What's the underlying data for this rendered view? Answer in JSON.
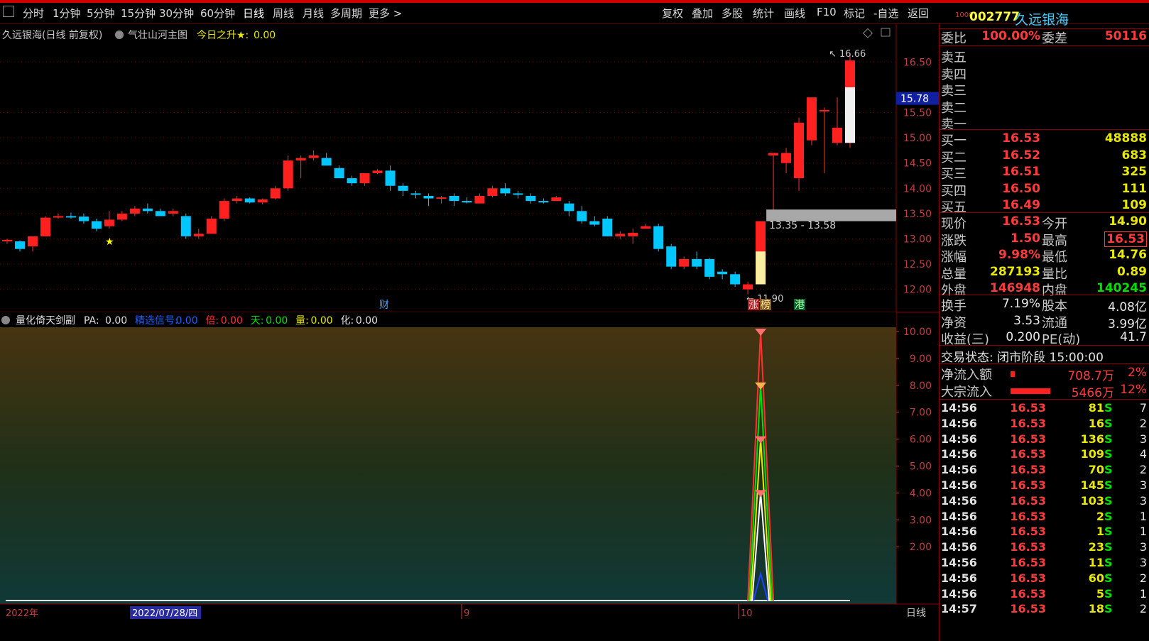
{
  "toolbar": {
    "left": [
      "分时",
      "1分钟",
      "5分钟",
      "15分钟",
      "30分钟",
      "60分钟",
      "日线",
      "周线",
      "月线",
      "多周期",
      "更多 >"
    ],
    "active": "日线",
    "right": [
      "复权",
      "叠加",
      "多股",
      "统计",
      "画线",
      "F10",
      "标记",
      "-自选",
      "返回"
    ]
  },
  "main_legend": {
    "stock": "久远银海(日线 前复权)",
    "indicator": "气壮山河主图",
    "today_rise_label": "今日之升★:",
    "today_rise_value": "0.00"
  },
  "sub_legend": {
    "name": "量化倚天剑副",
    "items": [
      {
        "label": "PA:",
        "value": "0.00",
        "color": "#e0e0e0"
      },
      {
        "label": "精选信号:",
        "value": "0.00",
        "color": "#2060ff"
      },
      {
        "label": "倍:",
        "value": "0.00",
        "color": "#ff3030"
      },
      {
        "label": "天:",
        "value": "0.00",
        "color": "#00e000"
      },
      {
        "label": "量:",
        "value": "0.00",
        "color": "#e8e800"
      },
      {
        "label": "化:",
        "value": "0.00",
        "color": "#e0e0e0"
      }
    ]
  },
  "chart_data": [
    {
      "type": "candlestick",
      "title": "久远银海(日线 前复权)",
      "yticks": [
        "16.50",
        "15.50",
        "15.00",
        "14.50",
        "14.00",
        "13.50",
        "13.00",
        "12.50",
        "12.00"
      ],
      "ylim": [
        11.7,
        16.8
      ],
      "current_price_tag": "15.78",
      "annotations": {
        "high": "16.66",
        "low": "11.90",
        "range_box": "13.35 - 13.58"
      },
      "markers": [
        "财",
        "涨",
        "榜",
        "港"
      ],
      "ohlc": [
        [
          12.95,
          13.0,
          12.9,
          12.98
        ],
        [
          12.95,
          12.97,
          12.75,
          12.8
        ],
        [
          12.85,
          13.05,
          12.75,
          13.05
        ],
        [
          13.05,
          13.45,
          13.05,
          13.42
        ],
        [
          13.42,
          13.5,
          13.4,
          13.45
        ],
        [
          13.45,
          13.52,
          13.4,
          13.44
        ],
        [
          13.44,
          13.5,
          13.3,
          13.35
        ],
        [
          13.35,
          13.4,
          13.15,
          13.2
        ],
        [
          13.25,
          13.55,
          13.2,
          13.38
        ],
        [
          13.38,
          13.55,
          13.35,
          13.5
        ],
        [
          13.5,
          13.65,
          13.45,
          13.6
        ],
        [
          13.6,
          13.7,
          13.5,
          13.55
        ],
        [
          13.55,
          13.6,
          13.45,
          13.45
        ],
        [
          13.5,
          13.6,
          13.45,
          13.55
        ],
        [
          13.45,
          13.5,
          13.0,
          13.05
        ],
        [
          13.05,
          13.2,
          13.0,
          13.1
        ],
        [
          13.1,
          13.45,
          13.1,
          13.4
        ],
        [
          13.4,
          13.8,
          13.35,
          13.75
        ],
        [
          13.75,
          13.85,
          13.7,
          13.8
        ],
        [
          13.8,
          13.82,
          13.7,
          13.72
        ],
        [
          13.72,
          13.8,
          13.68,
          13.78
        ],
        [
          13.8,
          14.05,
          13.78,
          14.0
        ],
        [
          14.0,
          14.65,
          13.95,
          14.55
        ],
        [
          14.55,
          14.65,
          14.2,
          14.6
        ],
        [
          14.6,
          14.75,
          14.55,
          14.65
        ],
        [
          14.6,
          14.7,
          14.45,
          14.45
        ],
        [
          14.4,
          14.45,
          14.2,
          14.2
        ],
        [
          14.2,
          14.25,
          14.05,
          14.1
        ],
        [
          14.1,
          14.3,
          14.05,
          14.3
        ],
        [
          14.3,
          14.38,
          14.28,
          14.35
        ],
        [
          14.35,
          14.45,
          13.95,
          14.05
        ],
        [
          14.05,
          14.1,
          13.85,
          13.95
        ],
        [
          13.9,
          13.95,
          13.8,
          13.88
        ],
        [
          13.85,
          13.9,
          13.65,
          13.8
        ],
        [
          13.8,
          13.85,
          13.7,
          13.82
        ],
        [
          13.85,
          13.9,
          13.65,
          13.75
        ],
        [
          13.75,
          13.82,
          13.7,
          13.72
        ],
        [
          13.7,
          13.9,
          13.7,
          13.85
        ],
        [
          13.85,
          14.05,
          13.82,
          14.0
        ],
        [
          14.0,
          14.1,
          13.85,
          13.9
        ],
        [
          13.9,
          13.95,
          13.8,
          13.88
        ],
        [
          13.85,
          13.9,
          13.7,
          13.75
        ],
        [
          13.75,
          13.8,
          13.7,
          13.72
        ],
        [
          13.75,
          13.85,
          13.75,
          13.82
        ],
        [
          13.7,
          13.75,
          13.45,
          13.55
        ],
        [
          13.55,
          13.65,
          13.3,
          13.35
        ],
        [
          13.35,
          13.45,
          13.25,
          13.28
        ],
        [
          13.4,
          13.45,
          13.05,
          13.05
        ],
        [
          13.05,
          13.15,
          13.0,
          13.1
        ],
        [
          13.05,
          13.2,
          12.9,
          13.12
        ],
        [
          13.2,
          13.3,
          13.2,
          13.25
        ],
        [
          13.25,
          13.3,
          12.75,
          12.8
        ],
        [
          12.85,
          12.9,
          12.4,
          12.45
        ],
        [
          12.45,
          12.65,
          12.4,
          12.6
        ],
        [
          12.6,
          12.75,
          12.4,
          12.45
        ],
        [
          12.6,
          12.62,
          12.2,
          12.25
        ],
        [
          12.35,
          12.4,
          12.2,
          12.3
        ],
        [
          12.3,
          12.35,
          12.05,
          12.1
        ],
        [
          12.0,
          12.15,
          11.9,
          12.1
        ],
        [
          12.1,
          13.35,
          12.1,
          13.35
        ],
        [
          14.65,
          14.7,
          13.5,
          14.7
        ],
        [
          14.5,
          14.8,
          14.3,
          14.7
        ],
        [
          14.2,
          15.4,
          13.95,
          15.3
        ],
        [
          14.95,
          15.8,
          14.85,
          15.8
        ],
        [
          15.55,
          15.6,
          14.3,
          15.55
        ],
        [
          14.9,
          15.8,
          14.85,
          15.2
        ],
        [
          14.9,
          16.66,
          14.8,
          16.53
        ]
      ]
    },
    {
      "type": "line",
      "title": "量化倚天剑副",
      "yticks": [
        "10.00",
        "9.00",
        "8.00",
        "7.00",
        "6.00",
        "5.00",
        "4.00",
        "3.00",
        "2.00"
      ],
      "ylim": [
        0,
        10
      ],
      "peak_index": 59,
      "series": [
        {
          "color": "#ff3030",
          "peak": 10
        },
        {
          "color": "#00e000",
          "peak": 8
        },
        {
          "color": "#e8e800",
          "peak": 6
        },
        {
          "color": "#ffffff",
          "peak": 4
        },
        {
          "color": "#2040ff",
          "peak": 1
        }
      ]
    }
  ],
  "xaxis": {
    "year": "2022年",
    "cursor_date": "2022/07/28/四",
    "months": [
      "9",
      "10"
    ],
    "period": "日线"
  },
  "quote": {
    "code": "002777",
    "name": "久远银海",
    "code_prefix": "1000",
    "weibi_label": "委比",
    "weibi": "100.00%",
    "weicha_label": "委差",
    "weicha": "50116",
    "sells": [
      "卖五",
      "卖四",
      "卖三",
      "卖二",
      "卖一"
    ],
    "buys": [
      {
        "label": "买一",
        "price": "16.53",
        "vol": "48888"
      },
      {
        "label": "买二",
        "price": "16.52",
        "vol": "683"
      },
      {
        "label": "买三",
        "price": "16.51",
        "vol": "325"
      },
      {
        "label": "买四",
        "price": "16.50",
        "vol": "111"
      },
      {
        "label": "买五",
        "price": "16.49",
        "vol": "109"
      }
    ],
    "stats1": [
      {
        "l1": "现价",
        "v1": "16.53",
        "c1": "red",
        "l2": "今开",
        "v2": "14.90",
        "c2": "yel"
      },
      {
        "l1": "涨跌",
        "v1": "1.50",
        "c1": "red",
        "l2": "最高",
        "v2": "16.53",
        "c2": "red"
      },
      {
        "l1": "涨幅",
        "v1": "9.98%",
        "c1": "red",
        "l2": "最低",
        "v2": "14.76",
        "c2": "yel"
      },
      {
        "l1": "总量",
        "v1": "287193",
        "c1": "yel",
        "l2": "量比",
        "v2": "0.89",
        "c2": "yel"
      },
      {
        "l1": "外盘",
        "v1": "146948",
        "c1": "red",
        "l2": "内盘",
        "v2": "140245",
        "c2": "green"
      }
    ],
    "stats2": [
      {
        "l1": "换手",
        "v1": "7.19%",
        "l2": "股本",
        "v2": "4.08亿"
      },
      {
        "l1": "净资",
        "v1": "3.53",
        "l2": "流通",
        "v2": "3.99亿"
      },
      {
        "l1": "收益(三)",
        "v1": "0.200",
        "l2": "PE(动)",
        "v2": "41.7"
      }
    ],
    "trade_status": "交易状态: 闭市阶段 15:00:00",
    "flows": [
      {
        "label": "净流入额",
        "value": "708.7万",
        "pct": "2%",
        "bar": 0.02
      },
      {
        "label": "大宗流入",
        "value": "5466万",
        "pct": "12%",
        "bar": 0.35
      }
    ],
    "ticks": [
      [
        "14:56",
        "16.53",
        "81",
        "S",
        "7"
      ],
      [
        "14:56",
        "16.53",
        "16",
        "S",
        "2"
      ],
      [
        "14:56",
        "16.53",
        "136",
        "S",
        "3"
      ],
      [
        "14:56",
        "16.53",
        "109",
        "S",
        "4"
      ],
      [
        "14:56",
        "16.53",
        "70",
        "S",
        "2"
      ],
      [
        "14:56",
        "16.53",
        "145",
        "S",
        "3"
      ],
      [
        "14:56",
        "16.53",
        "103",
        "S",
        "3"
      ],
      [
        "14:56",
        "16.53",
        "2",
        "S",
        "1"
      ],
      [
        "14:56",
        "16.53",
        "1",
        "S",
        "1"
      ],
      [
        "14:56",
        "16.53",
        "23",
        "S",
        "3"
      ],
      [
        "14:56",
        "16.53",
        "11",
        "S",
        "3"
      ],
      [
        "14:56",
        "16.53",
        "60",
        "S",
        "2"
      ],
      [
        "14:56",
        "16.53",
        "5",
        "S",
        "1"
      ],
      [
        "14:57",
        "16.53",
        "18",
        "S",
        "2"
      ]
    ]
  }
}
